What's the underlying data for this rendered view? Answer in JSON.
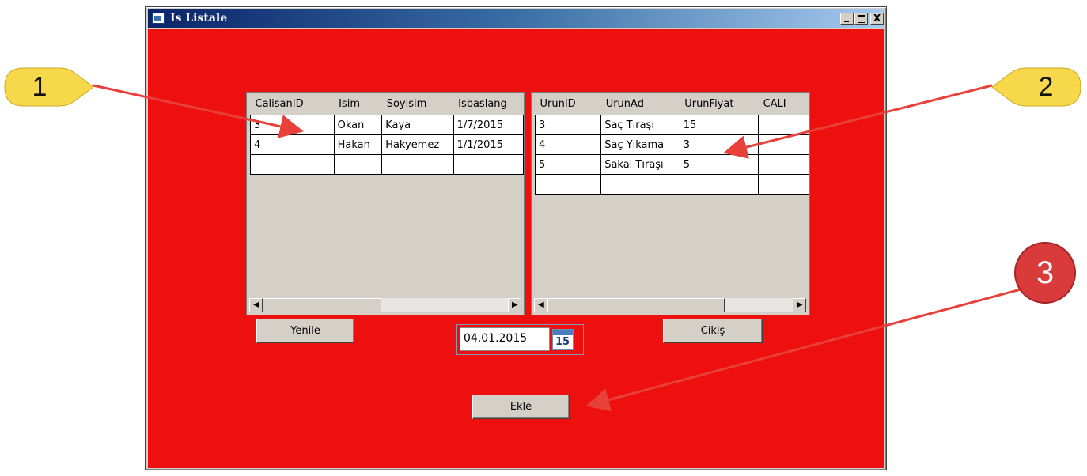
{
  "window": {
    "title": "Is Listale",
    "close_glyph": "X"
  },
  "grid_workers": {
    "columns": [
      "CalisanID",
      "Isim",
      "Soyisim",
      "Isbaslang"
    ],
    "rows": [
      [
        "3",
        "Okan",
        "Kaya",
        "1/7/2015"
      ],
      [
        "4",
        "Hakan",
        "Hakyemez",
        "1/1/2015"
      ]
    ]
  },
  "grid_products": {
    "columns": [
      "UrunID",
      "UrunAd",
      "UrunFiyat",
      "CALI"
    ],
    "rows": [
      [
        "3",
        "Saç Tıraşı",
        "15",
        ""
      ],
      [
        "4",
        "Saç Yıkama",
        "3",
        ""
      ],
      [
        "5",
        "Sakal Tıraşı",
        "5",
        ""
      ]
    ]
  },
  "buttons": {
    "refresh": "Yenile",
    "exit": "Cikiş",
    "add": "Ekle"
  },
  "date_picker": {
    "value": "04.01.2015",
    "calendar_day": "15"
  },
  "annotations": [
    "1",
    "2",
    "3"
  ],
  "colors": {
    "client_background": "#ee0f0f",
    "callout_yellow": "#f7d84a",
    "callout_red": "#d93a3a",
    "arrow": "#e8403a"
  }
}
